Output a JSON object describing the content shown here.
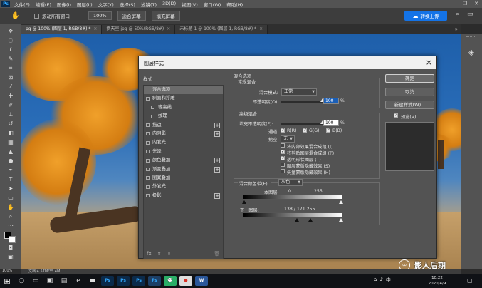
{
  "menubar": {
    "app_logo": "Ps",
    "items": [
      "文件(F)",
      "编辑(E)",
      "图像(I)",
      "图层(L)",
      "文字(Y)",
      "选择(S)",
      "滤镜(T)",
      "3D(D)",
      "视图(V)",
      "窗口(W)",
      "帮助(H)"
    ],
    "window_controls": [
      "—",
      "❐",
      "✕"
    ]
  },
  "optbar": {
    "tool_icon": "hand-icon",
    "scroll_all_label": "滚动所有窗口",
    "zoom_value": "100%",
    "fit_screen_label": "适合屏幕",
    "fill_screen_label": "填充屏幕",
    "share_label": "转换上传"
  },
  "tabs": [
    {
      "label": "pg @ 100% (图层 1, RGB/8#) *",
      "active": true
    },
    {
      "label": "换天空.jpg @ 50%(RGB/8#)",
      "active": false
    },
    {
      "label": "未标题-1 @ 100% (图层 1, RGB/8#) *",
      "active": false
    }
  ],
  "tabs_more": "»",
  "dialog": {
    "title": "图层样式",
    "styles_header": "样式",
    "styles": [
      {
        "label": "混合选项",
        "selected": true,
        "checkbox": false,
        "sub": false,
        "plus": false
      },
      {
        "label": "斜面和浮雕",
        "selected": false,
        "checkbox": true,
        "sub": false,
        "plus": false
      },
      {
        "label": "等高线",
        "selected": false,
        "checkbox": true,
        "sub": true,
        "plus": false
      },
      {
        "label": "纹理",
        "selected": false,
        "checkbox": true,
        "sub": true,
        "plus": false
      },
      {
        "label": "描边",
        "selected": false,
        "checkbox": true,
        "sub": false,
        "plus": true
      },
      {
        "label": "内阴影",
        "selected": false,
        "checkbox": true,
        "sub": false,
        "plus": true
      },
      {
        "label": "内发光",
        "selected": false,
        "checkbox": true,
        "sub": false,
        "plus": false
      },
      {
        "label": "光泽",
        "selected": false,
        "checkbox": true,
        "sub": false,
        "plus": false
      },
      {
        "label": "颜色叠加",
        "selected": false,
        "checkbox": true,
        "sub": false,
        "plus": true
      },
      {
        "label": "渐变叠加",
        "selected": false,
        "checkbox": true,
        "sub": false,
        "plus": true
      },
      {
        "label": "图案叠加",
        "selected": false,
        "checkbox": true,
        "sub": false,
        "plus": false
      },
      {
        "label": "外发光",
        "selected": false,
        "checkbox": true,
        "sub": false,
        "plus": false
      },
      {
        "label": "投影",
        "selected": false,
        "checkbox": true,
        "sub": false,
        "plus": true
      }
    ],
    "footer_fx": "fx",
    "footer_up": "⇧",
    "footer_down": "⇩",
    "footer_trash": "🗑",
    "blending": {
      "section_title": "混合选项",
      "general_title": "常规混合",
      "mode_label": "混合模式:",
      "mode_value": "正常",
      "opacity_label": "不透明度(O):",
      "opacity_value": "100",
      "opacity_unit": "%",
      "opacity_level": 1.0,
      "advanced_title": "高级混合",
      "fill_label": "填充不透明度(F):",
      "fill_value": "100",
      "fill_unit": "%",
      "fill_level": 1.0,
      "channels_label": "通道:",
      "channel_r": "R(R)",
      "channel_g": "G(G)",
      "channel_b": "B(B)",
      "knockout_label": "挖空:",
      "knockout_value": "无",
      "options": [
        {
          "label": "将内部效果混合成组 (I)",
          "checked": false
        },
        {
          "label": "将剪贴图层混合成组 (P)",
          "checked": true
        },
        {
          "label": "透明形状图层 (T)",
          "checked": true
        },
        {
          "label": "图层蒙版隐藏效果 (S)",
          "checked": false
        },
        {
          "label": "矢量蒙版隐藏效果 (H)",
          "checked": false
        }
      ],
      "blend_if_label": "混合颜色带(E):",
      "blend_if_value": "灰色",
      "this_layer_label": "本图层:",
      "this_layer_low": "0",
      "this_layer_high": "255",
      "under_layer_label": "下一图层:",
      "under_layer_values": "138 / 171 255"
    },
    "buttons": {
      "ok": "确定",
      "cancel": "取消",
      "new_style": "新建样式(W)...",
      "preview_label": "预览(V)"
    }
  },
  "status": {
    "zoom": "100%",
    "doc_info": "文档:4.57M/35.4M"
  },
  "taskbar": {
    "apps": [
      {
        "name": "ps-app-1",
        "label": "Ps",
        "bg": "#0b2a4a",
        "fg": "#31a8ff"
      },
      {
        "name": "ps-app-2",
        "label": "Ps",
        "bg": "#0b2a4a",
        "fg": "#31a8ff"
      },
      {
        "name": "ps-app-3",
        "label": "Ps",
        "bg": "#0b2a4a",
        "fg": "#31a8ff"
      },
      {
        "name": "ps-app-active",
        "label": "Ps",
        "bg": "#1d3f66",
        "fg": "#31a8ff"
      },
      {
        "name": "wechat-app",
        "label": "💬",
        "bg": "#2aae67",
        "fg": "#fff"
      },
      {
        "name": "chrome-app",
        "label": "●",
        "bg": "#dddddd",
        "fg": "#d93025"
      },
      {
        "name": "word-app",
        "label": "W",
        "bg": "#2b579a",
        "fg": "#fff"
      }
    ],
    "clock_time": "10:22",
    "clock_date": "2020/4/9",
    "lang_icon": "中"
  },
  "watermark": {
    "logo": "∞",
    "text": "影人后期"
  },
  "colors": {
    "accent": "#1473e6",
    "dialog_bg": "#535353",
    "toolbar_bg": "#535353"
  }
}
